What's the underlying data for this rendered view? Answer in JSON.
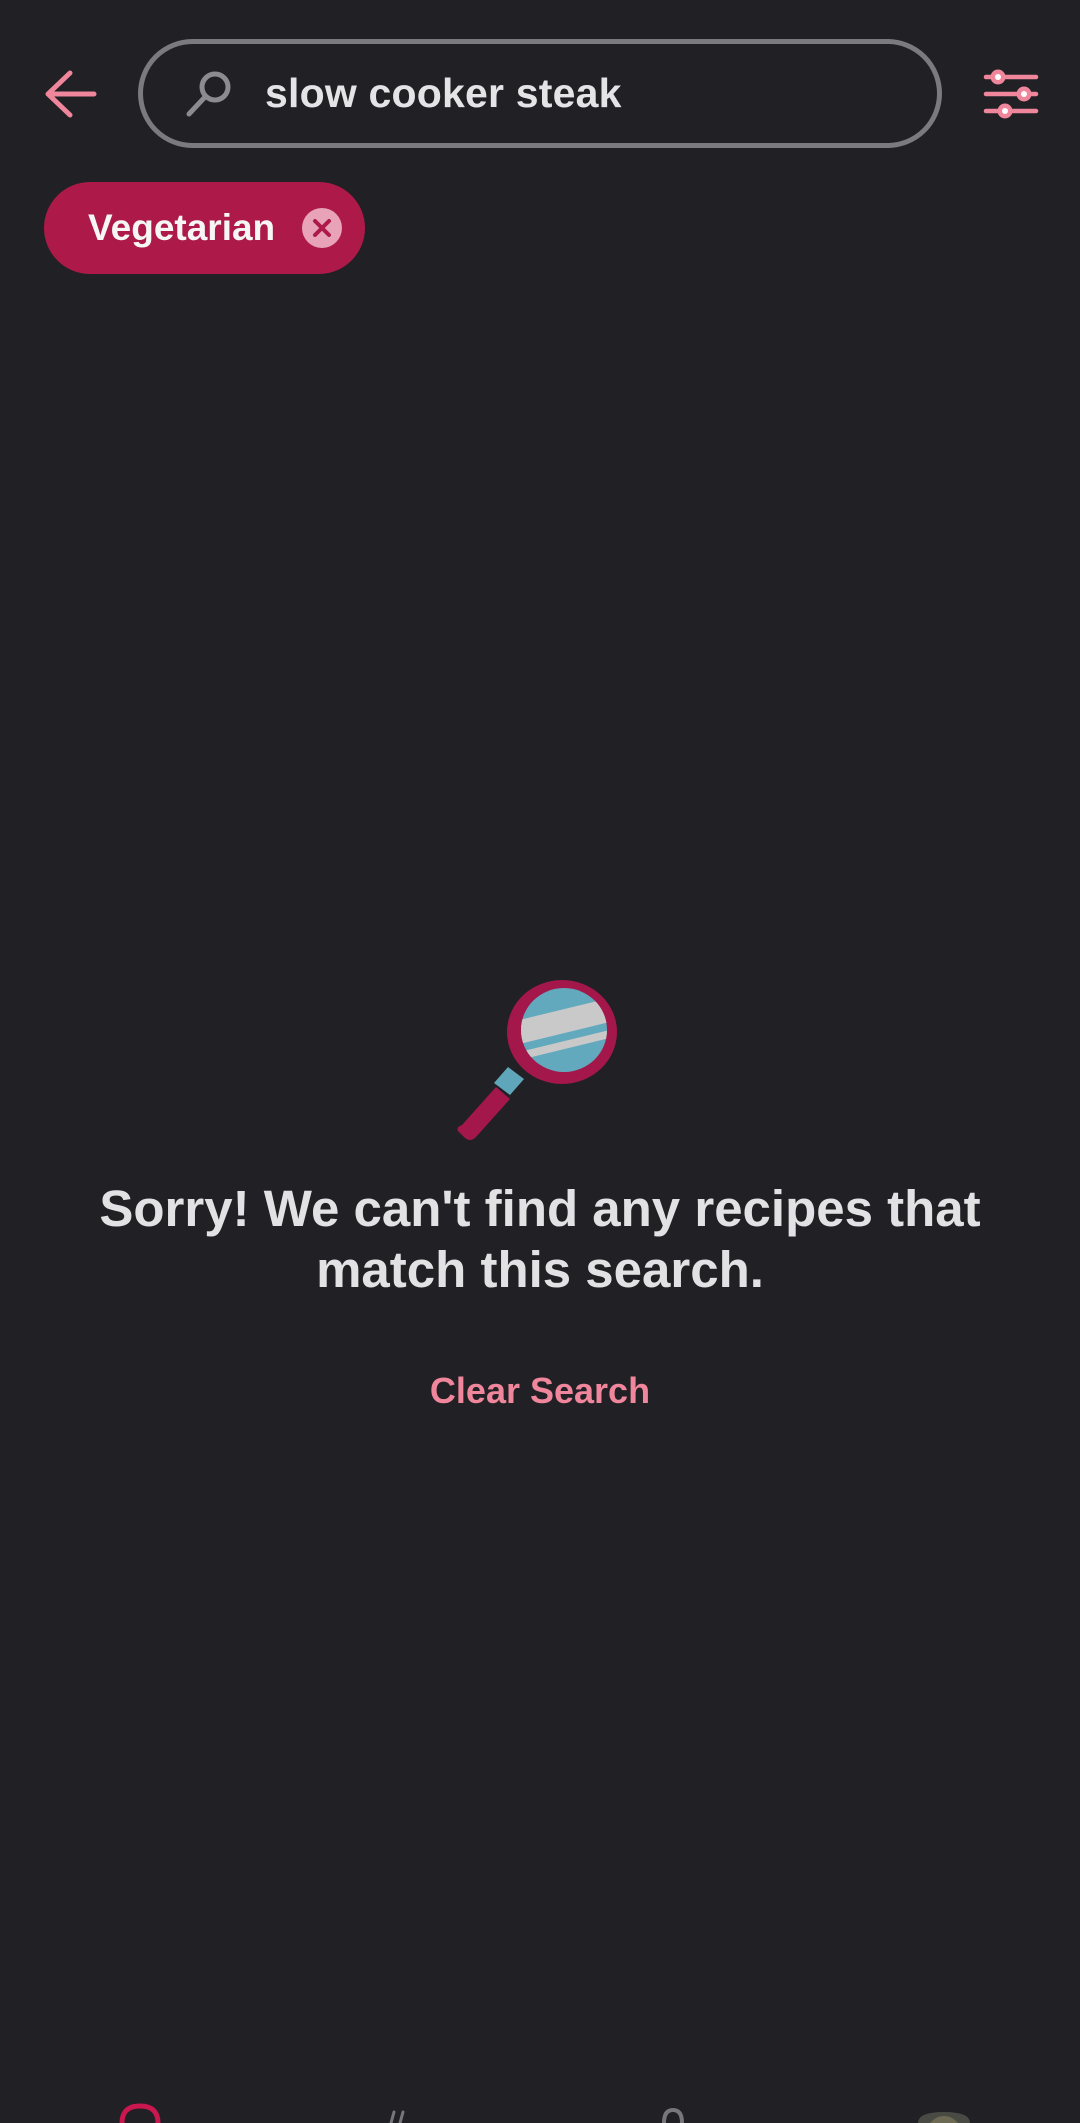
{
  "header": {
    "back_icon": "arrow-left-icon",
    "search": {
      "value": "slow cooker steak",
      "icon": "search-icon"
    },
    "filter_icon": "sliders-icon"
  },
  "filters": {
    "chips": [
      {
        "label": "Vegetarian",
        "remove_icon": "close-circle-icon"
      }
    ]
  },
  "empty_state": {
    "illustration": "magnifying-glass-illustration",
    "message": "Sorry! We can't find any recipes that match this search.",
    "action_label": "Clear Search"
  },
  "bottom_nav": {
    "items": [
      "home-icon",
      "recipes-icon",
      "search-icon",
      "profile-avatar"
    ]
  },
  "colors": {
    "background": "#212025",
    "accent": "#f0869c",
    "chip": "#ad1a4a",
    "text": "#e2e2e4",
    "search_border": "#7b7a7f"
  }
}
